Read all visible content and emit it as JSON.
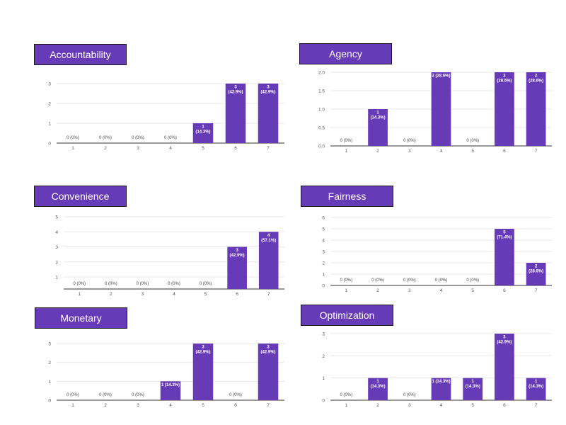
{
  "colors": {
    "bar": "#673ab7",
    "title_bg": "#673ab7",
    "title_text": "#ffffff",
    "grid": "#e8e8e8",
    "axis": "#333333",
    "tick": "#555555",
    "label_out": "#444444",
    "label_in": "#ffffff"
  },
  "chart_data": [
    {
      "type": "bar",
      "title": "Accountability",
      "categories": [
        "1",
        "2",
        "3",
        "4",
        "5",
        "6",
        "7"
      ],
      "values": [
        0,
        0,
        0,
        0,
        1,
        3,
        3
      ],
      "data_labels": [
        "0 (0%)",
        "0 (0%)",
        "0 (0%)",
        "0 (0%)",
        "1\n(14.3%)",
        "3\n(42.9%)",
        "3\n(42.9%)"
      ],
      "yticks": [
        "0",
        "1",
        "2",
        "3"
      ],
      "ylim": [
        0,
        3
      ],
      "grid": true
    },
    {
      "type": "bar",
      "title": "Agency",
      "categories": [
        "1",
        "2",
        "3",
        "4",
        "5",
        "6",
        "7"
      ],
      "values": [
        0,
        1,
        0,
        2,
        0,
        2,
        2
      ],
      "data_labels": [
        "0 (0%)",
        "1\n(14.3%)",
        "0 (0%)",
        "2 (28.6%)",
        "0 (0%)",
        "2\n(28.6%)",
        "2\n(28.6%)"
      ],
      "yticks": [
        "0.0",
        "0.5",
        "1.0",
        "1.5",
        "2.0"
      ],
      "ylim": [
        0,
        2
      ],
      "grid": true
    },
    {
      "type": "bar",
      "title": "Convenience",
      "categories": [
        "1",
        "2",
        "3",
        "4",
        "5",
        "6",
        "7"
      ],
      "values": [
        0,
        0,
        0,
        0,
        0,
        3,
        4
      ],
      "data_labels": [
        "0 (0%)",
        "0 (0%)",
        "0 (0%)",
        "0 (0%)",
        "0 (0%)",
        "3\n(42.9%)",
        "4\n(57.1%)"
      ],
      "yticks": [
        "1",
        "2",
        "3",
        "4",
        "5"
      ],
      "ylim": [
        0.2,
        5
      ],
      "grid": true
    },
    {
      "type": "bar",
      "title": "Fairness",
      "categories": [
        "1",
        "2",
        "3",
        "4",
        "5",
        "6",
        "7"
      ],
      "values": [
        0,
        0,
        0,
        0,
        0,
        5,
        2
      ],
      "data_labels": [
        "0 (0%)",
        "0 (0%)",
        "0 (0%)",
        "0 (0%)",
        "0 (0%)",
        "5\n(71.4%)",
        "2\n(28.6%)"
      ],
      "yticks": [
        "0",
        "1",
        "2",
        "3",
        "4",
        "5",
        "6"
      ],
      "ylim": [
        0,
        6
      ],
      "grid": true
    },
    {
      "type": "bar",
      "title": "Monetary",
      "categories": [
        "1",
        "2",
        "3",
        "4",
        "5",
        "6",
        "7"
      ],
      "values": [
        0,
        0,
        0,
        1,
        3,
        0,
        3
      ],
      "data_labels": [
        "0 (0%)",
        "0 (0%)",
        "0 (0%)",
        "1 (14.3%)",
        "3\n(42.9%)",
        "0 (0%)",
        "3\n(42.9%)"
      ],
      "yticks": [
        "0",
        "1",
        "2",
        "3"
      ],
      "ylim": [
        0,
        3
      ],
      "grid": true
    },
    {
      "type": "bar",
      "title": "Optimization",
      "categories": [
        "1",
        "2",
        "3",
        "4",
        "5",
        "6",
        "7"
      ],
      "values": [
        0,
        1,
        0,
        1,
        1,
        3,
        1
      ],
      "data_labels": [
        "0 (0%)",
        "1\n(14.3%)",
        "0 (0%)",
        "1 (14.3%)",
        "1\n(14.3%)",
        "3\n(42.9%)",
        "1\n(14.3%)"
      ],
      "yticks": [
        "0",
        "1",
        "2",
        "3"
      ],
      "ylim": [
        0,
        3
      ],
      "grid": true
    }
  ]
}
